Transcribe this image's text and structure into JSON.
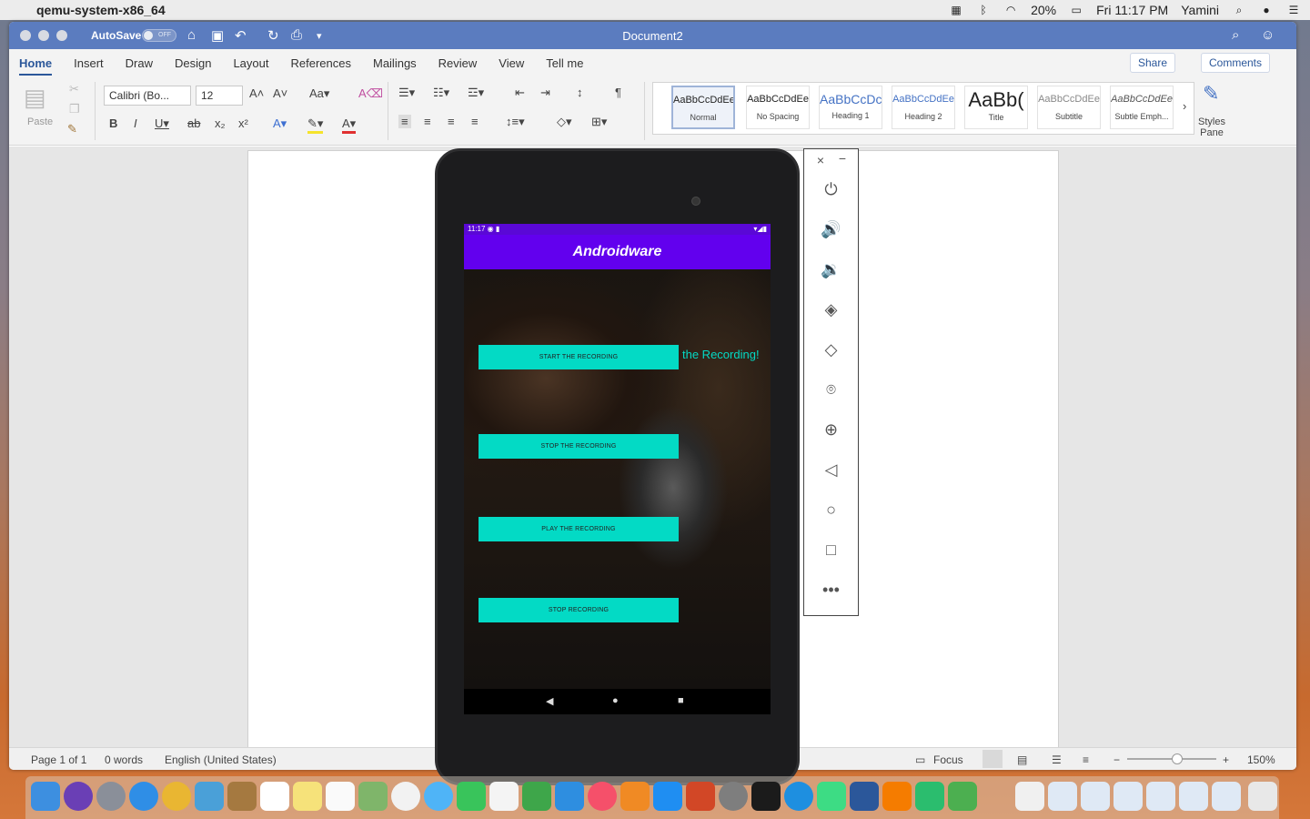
{
  "menubar": {
    "app_name": "qemu-system-x86_64",
    "battery": "20%",
    "datetime": "Fri 11:17 PM",
    "user": "Yamini"
  },
  "titlebar": {
    "autosave": "AutoSave",
    "toggle": "OFF",
    "doc_title": "Document2"
  },
  "tabs": [
    "Home",
    "Insert",
    "Draw",
    "Design",
    "Layout",
    "References",
    "Mailings",
    "Review",
    "View",
    "Tell me"
  ],
  "actions": {
    "share": "Share",
    "comments": "Comments"
  },
  "ribbon": {
    "paste": "Paste",
    "font_name": "Calibri (Bo...",
    "font_size": "12",
    "styles_pane": "Styles Pane",
    "styles": [
      {
        "preview": "AaBbCcDdEe",
        "name": "Normal"
      },
      {
        "preview": "AaBbCcDdEe",
        "name": "No Spacing"
      },
      {
        "preview": "AaBbCcDc",
        "name": "Heading 1"
      },
      {
        "preview": "AaBbCcDdEe",
        "name": "Heading 2"
      },
      {
        "preview": "AaBb(",
        "name": "Title"
      },
      {
        "preview": "AaBbCcDdEe",
        "name": "Subtitle"
      },
      {
        "preview": "AaBbCcDdEe",
        "name": "Subtle Emph..."
      }
    ]
  },
  "statusbar": {
    "page": "Page 1 of 1",
    "words": "0 words",
    "language": "English (United States)",
    "focus": "Focus",
    "zoom": "150%"
  },
  "emulator": {
    "time": "11:17",
    "app_title": "Androidware",
    "buttons": [
      "START THE RECORDING",
      "STOP THE RECORDING",
      "PLAY THE RECORDING",
      "STOP RECORDING"
    ],
    "status_text": "the Recording!"
  },
  "colors": {
    "title_bar": "#5b7cbf",
    "app_bar": "#6200ee",
    "button": "#03dac5",
    "accent": "#2b579a"
  }
}
